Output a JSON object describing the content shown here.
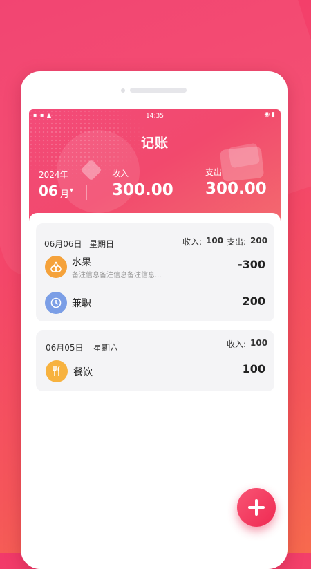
{
  "status_bar": {
    "left": "▪ ▪ ▲",
    "time": "14:35",
    "right": "◉ ▮"
  },
  "header": {
    "title": "记账",
    "year": "2024年",
    "month": "06",
    "month_unit": "月",
    "month_caret": "▾",
    "income_label": "收入",
    "income_value": "300.00",
    "expense_label": "支出",
    "expense_value": "300.00"
  },
  "days": [
    {
      "date": "06月06日",
      "weekday": "星期日",
      "income_label": "收入:",
      "income": "100",
      "expense_label": "支出:",
      "expense": "200",
      "entries": [
        {
          "category": "水果",
          "note": "备注信息备注信息备注信息...",
          "amount": "-300",
          "icon": "fruit-icon",
          "color": "#f5a23b"
        },
        {
          "category": "兼职",
          "note": "",
          "amount": "200",
          "icon": "clock-icon",
          "color": "#7b9ee6"
        }
      ]
    },
    {
      "date": "06月05日",
      "weekday": "星期六",
      "income_label": "收入:",
      "income": "100",
      "entries": [
        {
          "category": "餐饮",
          "note": "",
          "amount": "100",
          "icon": "utensils-icon",
          "color": "#f7b23f"
        }
      ]
    }
  ],
  "fab": {
    "icon": "plus-icon"
  },
  "colors": {
    "accent": "#f2496d",
    "fab": "#ef2a52"
  }
}
